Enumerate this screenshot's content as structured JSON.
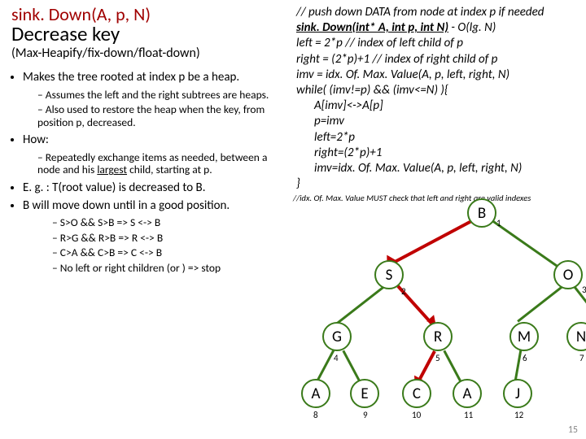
{
  "title": {
    "line1": "sink. Down(A, p, N)",
    "line2": "Decrease key",
    "line3": "(Max-Heapify/fix-down/float-down)"
  },
  "bullets": {
    "b1": "Makes the tree rooted at index p be a heap.",
    "b1s1": "Assumes the left and the right subtrees are heaps.",
    "b1s2": "Also used to restore the heap when the key, from position p, decreased.",
    "b2": "How:",
    "b2s1_a": "Repeatedly exchange items as needed, between a node and his ",
    "b2s1_b": "largest",
    "b2s1_c": " child, starting at p.",
    "b3": "E. g. :   T(root value) is decreased to B.",
    "b4": "B will move down until in a good position.",
    "b4s1": "S>O && S>B => S <-> B",
    "b4s2": "R>G && R>B => R <-> B",
    "b4s3": "C>A && C>B => C <-> B",
    "b4s4": "No left or right children (or ) => stop"
  },
  "code": {
    "c0": "// push down DATA from node at index p if needed",
    "sig_a": "sink. Down(int* A, int p, int N)",
    "sig_b": "   - O(lg. N)",
    "c1": "left = 2*p          // index of left child of p",
    "c2": "right = (2*p)+1 // index of right child of p",
    "c3": "imv = idx. Of. Max. Value(A, p, left, right, N)",
    "c4": "while( (imv!=p) && (imv<=N) ){",
    "c5": "A[imv]<->A[p]",
    "c6": "p=imv",
    "c7": "left=2*p",
    "c8": "right=(2*p)+1",
    "c9": "imv=idx. Of. Max. Value(A, p, left, right, N)",
    "c10": "}",
    "note": "//idx. Of. Max. Value MUST check that left and right are valid indexes"
  },
  "tree": {
    "nodes": [
      {
        "label": "B",
        "idx": "1"
      },
      {
        "label": "S",
        "idx": "2"
      },
      {
        "label": "O",
        "idx": "3"
      },
      {
        "label": "G",
        "idx": "4"
      },
      {
        "label": "R",
        "idx": "5"
      },
      {
        "label": "M",
        "idx": "6"
      },
      {
        "label": "N",
        "idx": "7"
      },
      {
        "label": "A",
        "idx": "8"
      },
      {
        "label": "E",
        "idx": "9"
      },
      {
        "label": "C",
        "idx": "10"
      },
      {
        "label": "A",
        "idx": "11"
      },
      {
        "label": "J",
        "idx": "12"
      }
    ]
  },
  "page": "15"
}
